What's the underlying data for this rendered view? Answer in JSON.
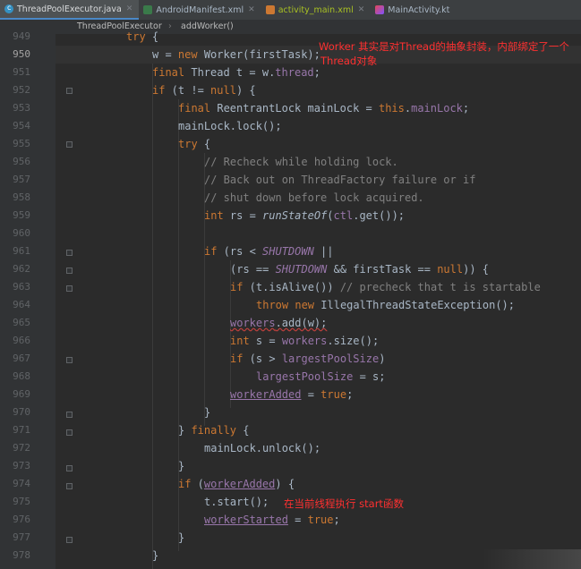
{
  "tabs": [
    {
      "label": "ThreadPoolExecutor.java",
      "active": true,
      "icon": "java-class-icon"
    },
    {
      "label": "AndroidManifest.xml",
      "active": false,
      "icon": "xml-file-icon"
    },
    {
      "label": "activity_main.xml",
      "active": false,
      "icon": "layout-file-icon"
    },
    {
      "label": "MainActivity.kt",
      "active": false,
      "icon": "kotlin-file-icon"
    }
  ],
  "breadcrumb": {
    "class_name": "ThreadPoolExecutor",
    "sep": "›",
    "method": "addWorker()"
  },
  "annotations": {
    "worker_note_1": "Worker 其实是对Thread的抽象封装，内部绑定了一个",
    "worker_note_2": "Thread对象",
    "start_note": "在当前线程执行 start函数"
  },
  "code_lines": [
    {
      "n": "949"
    },
    {
      "n": "950"
    },
    {
      "n": "951"
    },
    {
      "n": "952"
    },
    {
      "n": "953"
    },
    {
      "n": "954"
    },
    {
      "n": "955"
    },
    {
      "n": "956"
    },
    {
      "n": "957"
    },
    {
      "n": "958"
    },
    {
      "n": "959"
    },
    {
      "n": "960"
    },
    {
      "n": "961"
    },
    {
      "n": "962"
    },
    {
      "n": "963"
    },
    {
      "n": "964"
    },
    {
      "n": "965"
    },
    {
      "n": "966"
    },
    {
      "n": "967"
    },
    {
      "n": "968"
    },
    {
      "n": "969"
    },
    {
      "n": "970"
    },
    {
      "n": "971"
    },
    {
      "n": "972"
    },
    {
      "n": "973"
    },
    {
      "n": "974"
    },
    {
      "n": "975"
    },
    {
      "n": "976"
    },
    {
      "n": "977"
    },
    {
      "n": "978"
    }
  ],
  "tokens": {
    "try": "try",
    "brace_open": "{",
    "w_assign": "w = ",
    "new": "new",
    "worker_ctor": " Worker(firstTask);",
    "final": "final",
    "thread_decl": " Thread t = ",
    "w_ref": "w",
    "dot_thread": ".",
    "thread_field": "thread",
    "semi": ";",
    "if": "if",
    "t_not_null": " (t != ",
    "null": "null",
    "close_paren_brace": ") {",
    "reentrant": " ReentrantLock mainLock = ",
    "this": "this",
    "main_lock_field": "mainLock",
    "mainlock_lock": "mainLock.lock();",
    "c956": "// Recheck while holding lock.",
    "c957": "// Back out on ThreadFactory failure or if",
    "c958": "// shut down before lock acquired.",
    "int": "int",
    "rs_decl": " rs = ",
    "run_state_of": "runStateOf",
    "ctl_part_a": "(",
    "ctl": "ctl",
    "ctl_part_b": ".get());",
    "rs_lt": " (rs < ",
    "shutdown": "SHUTDOWN",
    "or": " ||",
    "rs_eq_open": "(rs == ",
    "and_first": " && firstTask == ",
    "close_close_brace": ")) {",
    "t_is_alive": " (t.isAlive()) ",
    "c963": "// precheck that t is startable",
    "throw": "throw",
    "illegal": " IllegalThreadStateException();",
    "workers": "workers",
    "add_w": ".add(w);",
    "s_decl": " s = ",
    "size_call": ".size();",
    "s_gt": " (s > ",
    "largest_pool_size": "largestPoolSize",
    "close_paren": ")",
    "largest_assign": " = s;",
    "worker_added": "workerAdded",
    "eq_": " = ",
    "true": "true",
    "brace_close": "}",
    "finally_brace_close": "} ",
    "finally": "finally",
    "unlock": "mainLock.unlock();",
    "open_paren": " (",
    "t_start": "t.start();",
    "worker_started": "workerStarted"
  }
}
